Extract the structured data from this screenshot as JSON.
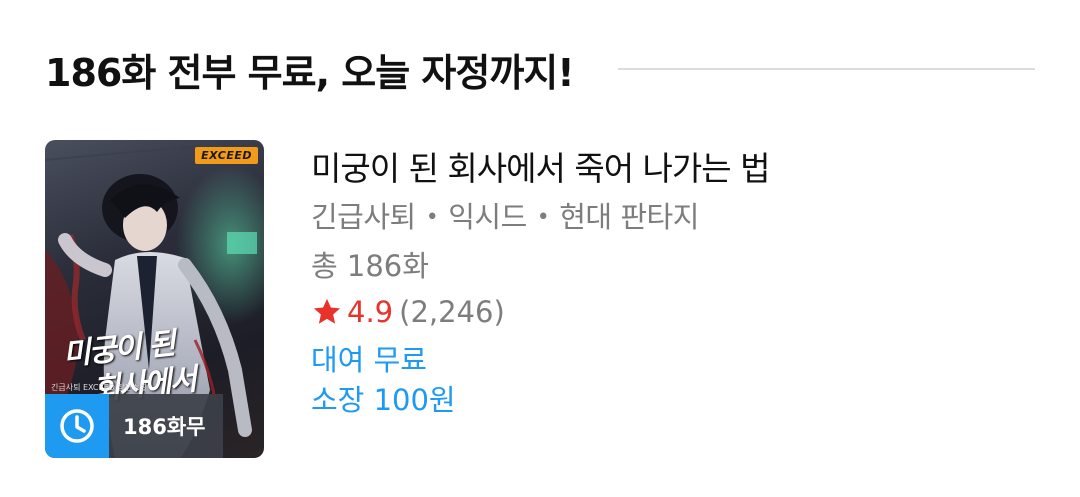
{
  "section": {
    "title": "186화 전부 무료, 오늘 자정까지!"
  },
  "work": {
    "title": "미궁이 된 회사에서 죽어 나가는 법",
    "author": "긴급사퇴",
    "publisher": "익시드",
    "genre": "현대 판타지",
    "separator": "•",
    "total_episodes": "총 186화",
    "rating": {
      "score": "4.9",
      "count": "(2,246)"
    },
    "rental": "대여 무료",
    "purchase": "소장 100원"
  },
  "cover": {
    "publisher_badge": "EXCEED",
    "title_line1": "미궁이 된",
    "title_line2": "회사에서",
    "small_text": "긴급사퇴 EXCEED 장편소설",
    "free_badge_label": "186화무",
    "free_badge_icon": "clock-icon"
  },
  "colors": {
    "accent_blue": "#1e9af0",
    "star_red": "#e8332a",
    "exceed_orange": "#f29a1a"
  }
}
